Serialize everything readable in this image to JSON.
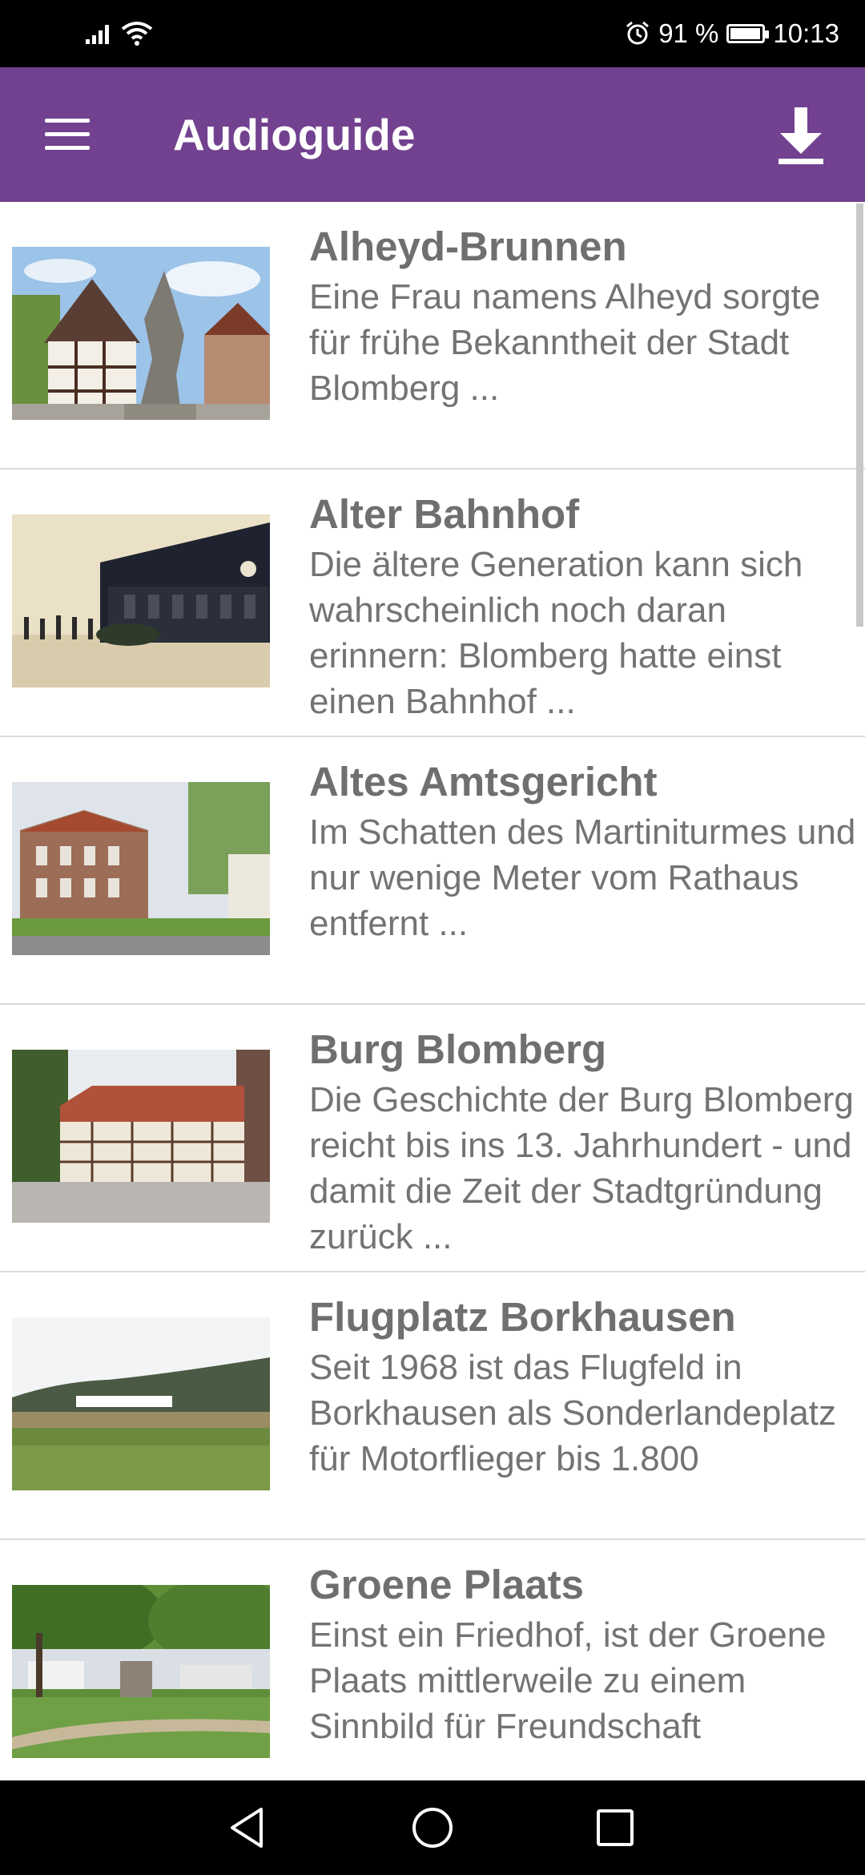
{
  "status_bar": {
    "battery_percent": "91 %",
    "time": "10:13",
    "icons": [
      "signal-icon",
      "wifi-icon",
      "alarm-icon",
      "battery-charging-icon"
    ]
  },
  "app_bar": {
    "title": "Audioguide",
    "menu_icon": "hamburger-menu-icon",
    "download_icon": "download-icon"
  },
  "items": [
    {
      "title": "Alheyd-Brunnen",
      "description": "Eine Frau namens Alheyd sorgte für frühe Bekanntheit der Stadt Blomberg ..."
    },
    {
      "title": "Alter Bahnhof",
      "description": "Die ältere Generation kann sich wahrscheinlich noch daran erinnern: Blomberg hatte einst einen Bahnhof ..."
    },
    {
      "title": "Altes Amtsgericht",
      "description": "Im Schatten des Martiniturmes und nur wenige Meter vom Rathaus entfernt ..."
    },
    {
      "title": "Burg Blomberg",
      "description": "Die Geschichte der Burg Blomberg reicht bis ins 13. Jahrhundert - und damit die Zeit der Stadtgründung zurück ..."
    },
    {
      "title": "Flugplatz Borkhausen",
      "description": "Seit 1968 ist das Flugfeld in Borkhausen als Sonderlandeplatz für Motorflieger bis 1.800"
    },
    {
      "title": "Groene Plaats",
      "description": "Einst ein Friedhof, ist der Groene Plaats mittlerweile zu einem Sinnbild für Freundschaft"
    }
  ],
  "colors": {
    "app_bar": "#72418f",
    "text": "#6f6f6f"
  }
}
